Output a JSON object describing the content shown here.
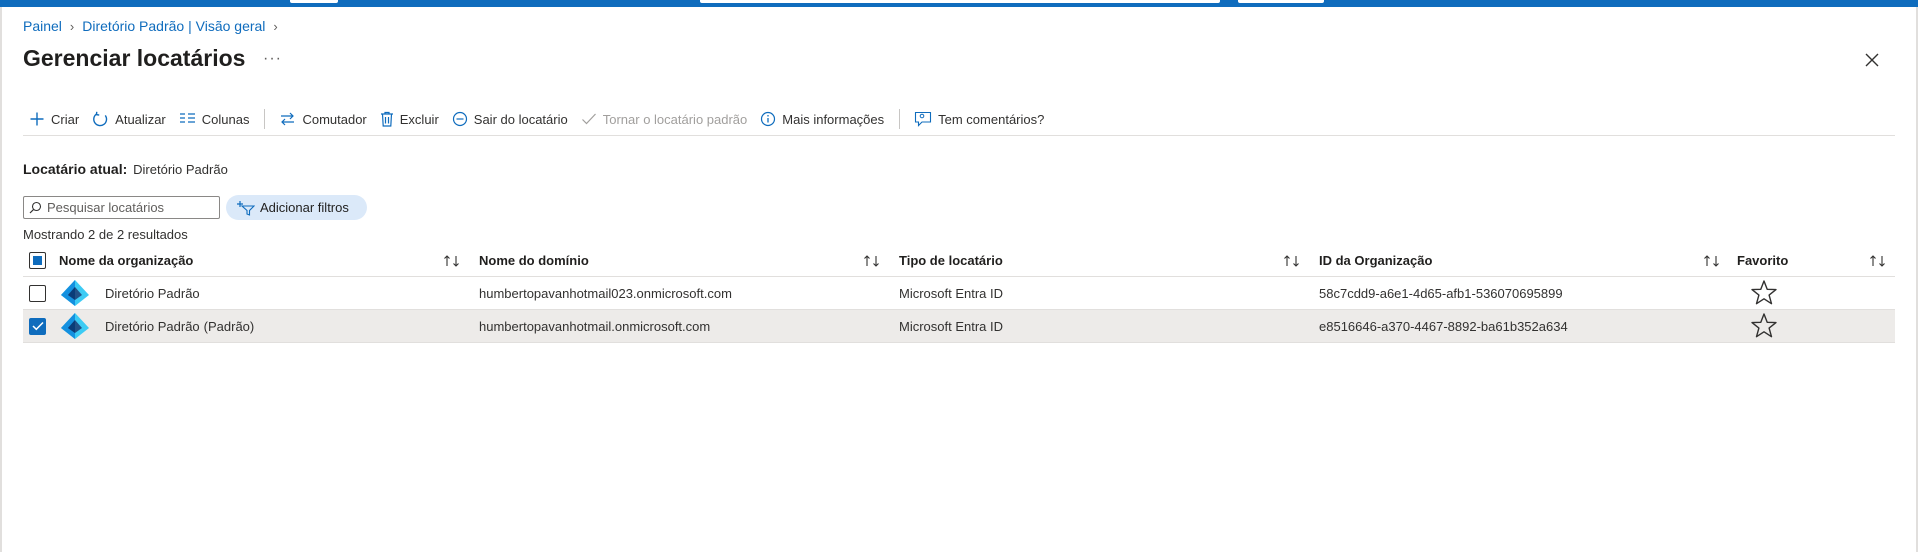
{
  "topbar": {
    "user_text": ""
  },
  "breadcrumb": {
    "items": [
      "Painel",
      "Diretório Padrão | Visão geral"
    ]
  },
  "page": {
    "title": "Gerenciar locatários",
    "more": "···"
  },
  "toolbar": {
    "create": "Criar",
    "refresh": "Atualizar",
    "columns": "Colunas",
    "switch": "Comutador",
    "delete": "Excluir",
    "leave": "Sair do locatário",
    "make_default": "Tornar o locatário padrão",
    "more_info": "Mais informações",
    "feedback": "Tem comentários?"
  },
  "current_tenant": {
    "label": "Locatário atual:",
    "value": "Diretório Padrão"
  },
  "search": {
    "placeholder": "Pesquisar locatários",
    "value": ""
  },
  "filters": {
    "add_label": "Adicionar filtros"
  },
  "results": {
    "summary": "Mostrando 2 de 2 resultados"
  },
  "table": {
    "columns": [
      "Nome da organização",
      "Nome do domínio",
      "Tipo de locatário",
      "ID da Organização",
      "Favorito"
    ],
    "rows": [
      {
        "name": "Diretório Padrão",
        "tag": "",
        "domain": "humbertopavanhotmail023.onmicrosoft.com",
        "type": "Microsoft Entra ID",
        "id": "58c7cdd9-a6e1-4d65-afb1-536070695899",
        "selected": false
      },
      {
        "name": "Diretório Padrão",
        "tag": "(Padrão)",
        "domain": "humbertopavanhotmail.onmicrosoft.com",
        "type": "Microsoft Entra ID",
        "id": "e8516646-a370-4467-8892-ba61b352a634",
        "selected": true
      }
    ]
  },
  "colors": {
    "accent": "#0f6cbd",
    "selected_row": "#edebe9",
    "pill": "#dbe9f9"
  }
}
